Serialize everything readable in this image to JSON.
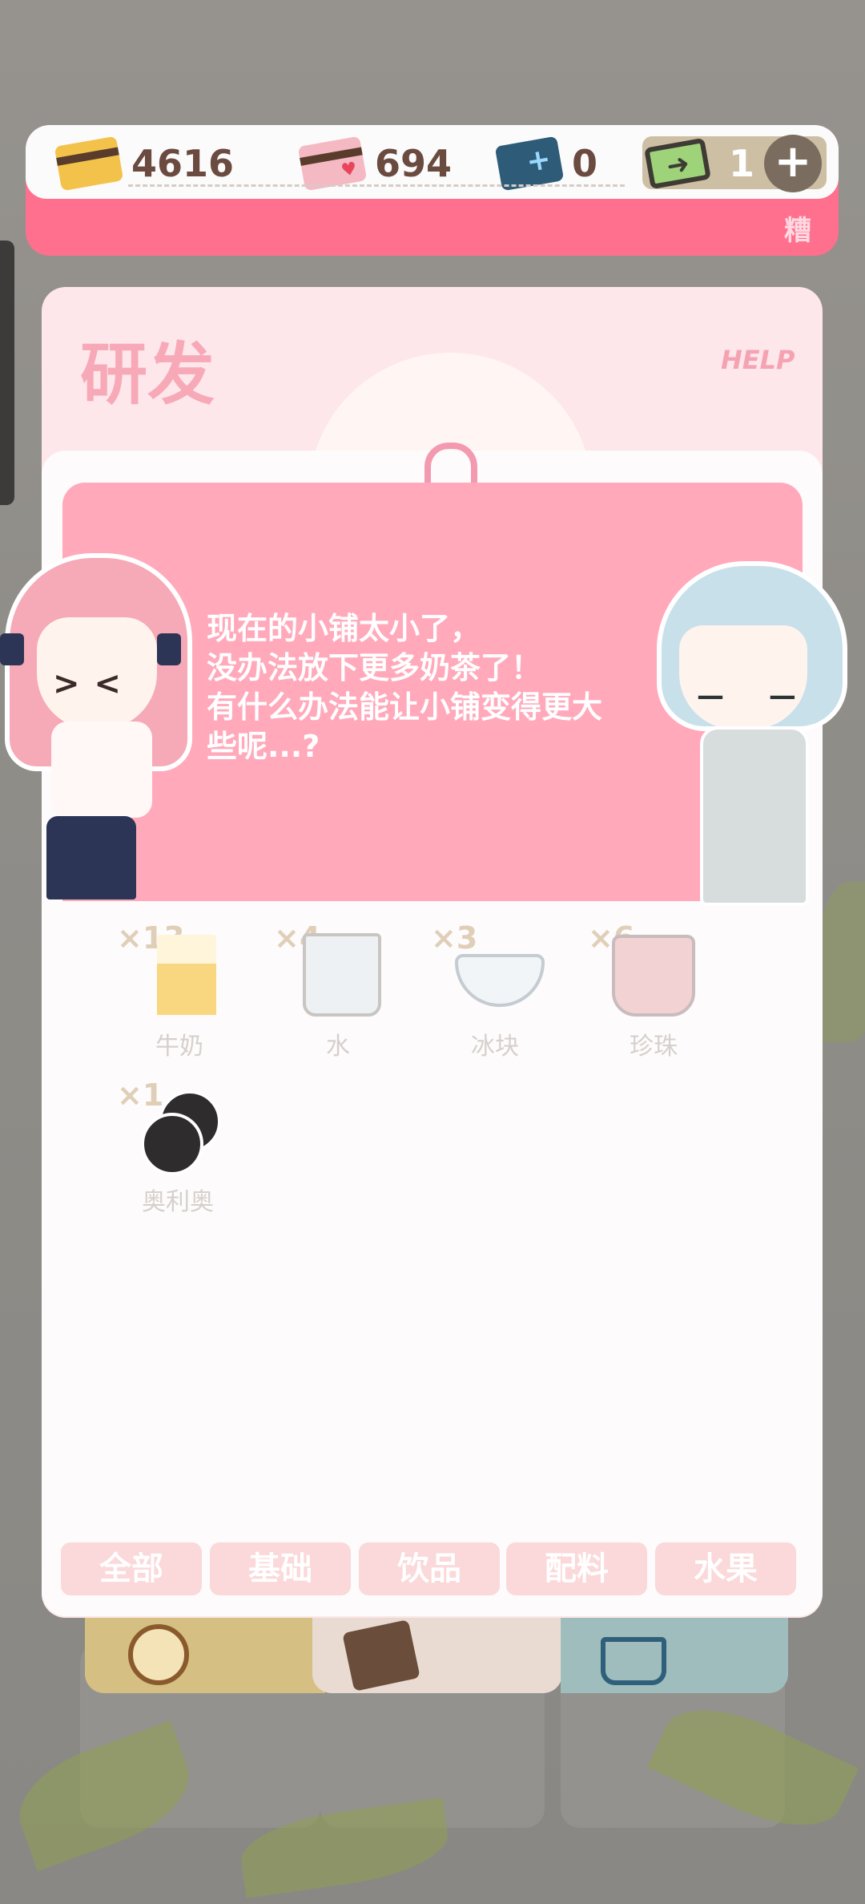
{
  "currencies": [
    {
      "name": "gold-card",
      "value": "4616"
    },
    {
      "name": "heart-card",
      "value": "694"
    },
    {
      "name": "blue-card",
      "value": "0"
    },
    {
      "name": "green-ticket",
      "value": "1"
    }
  ],
  "currency_bar": {
    "add_label": "+",
    "side_text": "糟"
  },
  "research": {
    "title": "研发",
    "help_label": "HELP"
  },
  "dialog": {
    "lines": [
      "现在的小铺太小了，",
      "没办法放下更多奶茶了！",
      "有什么办法能让小铺变得更大",
      "些呢...?"
    ]
  },
  "items": [
    {
      "label": "牛奶",
      "qty": "×13",
      "icon": "milk-carton-icon"
    },
    {
      "label": "水",
      "qty": "×4",
      "icon": "water-cup-icon"
    },
    {
      "label": "冰块",
      "qty": "×3",
      "icon": "ice-bowl-icon"
    },
    {
      "label": "珍珠",
      "qty": "×6",
      "icon": "pearl-cup-icon"
    },
    {
      "label": "奥利奥",
      "qty": "×1",
      "icon": "oreo-icon"
    }
  ],
  "tabs": [
    "全部",
    "基础",
    "饮品",
    "配料",
    "水果"
  ],
  "bottom_nav": [
    {
      "icon": "compass-icon",
      "color": "#d6bf83"
    },
    {
      "icon": "recipe-notebook-icon",
      "color": "#eadbd2"
    },
    {
      "icon": "basket-icon",
      "color": "#9fbdbc"
    }
  ]
}
